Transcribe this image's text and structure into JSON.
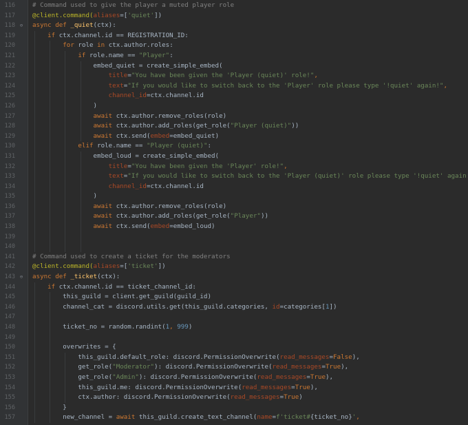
{
  "editor": {
    "lines": [
      {
        "n": "116",
        "tokens": [
          {
            "t": "# Command used to give the player a muted player role",
            "c": "com"
          }
        ]
      },
      {
        "n": "117",
        "tokens": [
          {
            "t": "@client.command(",
            "c": "dec"
          },
          {
            "t": "aliases",
            "c": "par"
          },
          {
            "t": "=[",
            "c": ""
          },
          {
            "t": "'quiet'",
            "c": "str"
          },
          {
            "t": "])",
            "c": ""
          }
        ]
      },
      {
        "n": "118",
        "fold": true,
        "tokens": [
          {
            "t": "async def ",
            "c": "kw"
          },
          {
            "t": "_quiet",
            "c": "fn"
          },
          {
            "t": "(ctx):",
            "c": ""
          }
        ]
      },
      {
        "n": "119",
        "tokens": [
          {
            "t": "    ",
            "c": ""
          },
          {
            "t": "if ",
            "c": "kw"
          },
          {
            "t": "ctx.channel.id == REGISTRATION_ID:",
            "c": ""
          }
        ]
      },
      {
        "n": "120",
        "tokens": [
          {
            "t": "        ",
            "c": ""
          },
          {
            "t": "for ",
            "c": "kw"
          },
          {
            "t": "role ",
            "c": ""
          },
          {
            "t": "in ",
            "c": "kw"
          },
          {
            "t": "ctx.author.roles:",
            "c": ""
          }
        ]
      },
      {
        "n": "121",
        "tokens": [
          {
            "t": "            ",
            "c": ""
          },
          {
            "t": "if ",
            "c": "kw"
          },
          {
            "t": "role.name == ",
            "c": ""
          },
          {
            "t": "\"Player\"",
            "c": "str"
          },
          {
            "t": ":",
            "c": ""
          }
        ]
      },
      {
        "n": "122",
        "tokens": [
          {
            "t": "                embed_quiet = create_simple_embed(",
            "c": ""
          }
        ]
      },
      {
        "n": "123",
        "tokens": [
          {
            "t": "                    ",
            "c": ""
          },
          {
            "t": "title",
            "c": "par"
          },
          {
            "t": "=",
            "c": ""
          },
          {
            "t": "\"You have been given the 'Player (quiet)' role!\"",
            "c": "str"
          },
          {
            "t": ",",
            "c": "sb"
          }
        ]
      },
      {
        "n": "124",
        "tokens": [
          {
            "t": "                    ",
            "c": ""
          },
          {
            "t": "text",
            "c": "par"
          },
          {
            "t": "=",
            "c": ""
          },
          {
            "t": "\"If you would like to switch back to the 'Player' role please type '!quiet' again!\"",
            "c": "str"
          },
          {
            "t": ",",
            "c": "sb"
          }
        ]
      },
      {
        "n": "125",
        "tokens": [
          {
            "t": "                    ",
            "c": ""
          },
          {
            "t": "channel_id",
            "c": "par"
          },
          {
            "t": "=ctx.channel.id",
            "c": ""
          }
        ]
      },
      {
        "n": "126",
        "tokens": [
          {
            "t": "                )",
            "c": ""
          }
        ]
      },
      {
        "n": "127",
        "tokens": [
          {
            "t": "                ",
            "c": ""
          },
          {
            "t": "await ",
            "c": "kw"
          },
          {
            "t": "ctx.author.remove_roles(role)",
            "c": ""
          }
        ]
      },
      {
        "n": "128",
        "tokens": [
          {
            "t": "                ",
            "c": ""
          },
          {
            "t": "await ",
            "c": "kw"
          },
          {
            "t": "ctx.author.add_roles(get_role(",
            "c": ""
          },
          {
            "t": "\"Player (quiet)\"",
            "c": "str"
          },
          {
            "t": "))",
            "c": ""
          }
        ]
      },
      {
        "n": "129",
        "tokens": [
          {
            "t": "                ",
            "c": ""
          },
          {
            "t": "await ",
            "c": "kw"
          },
          {
            "t": "ctx.send(",
            "c": ""
          },
          {
            "t": "embed",
            "c": "par"
          },
          {
            "t": "=embed_quiet)",
            "c": ""
          }
        ]
      },
      {
        "n": "130",
        "tokens": [
          {
            "t": "            ",
            "c": ""
          },
          {
            "t": "elif ",
            "c": "kw"
          },
          {
            "t": "role.name == ",
            "c": ""
          },
          {
            "t": "\"Player (quiet)\"",
            "c": "str"
          },
          {
            "t": ":",
            "c": ""
          }
        ]
      },
      {
        "n": "131",
        "tokens": [
          {
            "t": "                embed_loud = create_simple_embed(",
            "c": ""
          }
        ]
      },
      {
        "n": "132",
        "tokens": [
          {
            "t": "                    ",
            "c": ""
          },
          {
            "t": "title",
            "c": "par"
          },
          {
            "t": "=",
            "c": ""
          },
          {
            "t": "\"You have been given the 'Player' role!\"",
            "c": "str"
          },
          {
            "t": ",",
            "c": "sb"
          }
        ]
      },
      {
        "n": "133",
        "tokens": [
          {
            "t": "                    ",
            "c": ""
          },
          {
            "t": "text",
            "c": "par"
          },
          {
            "t": "=",
            "c": ""
          },
          {
            "t": "\"If you would like to switch back to the 'Player (quiet)' role please type '!quiet' again!\"",
            "c": "str"
          },
          {
            "t": ",",
            "c": "sb"
          }
        ]
      },
      {
        "n": "134",
        "tokens": [
          {
            "t": "                    ",
            "c": ""
          },
          {
            "t": "channel_id",
            "c": "par"
          },
          {
            "t": "=ctx.channel.id",
            "c": ""
          }
        ]
      },
      {
        "n": "135",
        "tokens": [
          {
            "t": "                )",
            "c": ""
          }
        ]
      },
      {
        "n": "136",
        "tokens": [
          {
            "t": "                ",
            "c": ""
          },
          {
            "t": "await ",
            "c": "kw"
          },
          {
            "t": "ctx.author.remove_roles(role)",
            "c": ""
          }
        ]
      },
      {
        "n": "137",
        "tokens": [
          {
            "t": "                ",
            "c": ""
          },
          {
            "t": "await ",
            "c": "kw"
          },
          {
            "t": "ctx.author.add_roles(get_role(",
            "c": ""
          },
          {
            "t": "\"Player\"",
            "c": "str"
          },
          {
            "t": "))",
            "c": ""
          }
        ]
      },
      {
        "n": "138",
        "tokens": [
          {
            "t": "                ",
            "c": ""
          },
          {
            "t": "await ",
            "c": "kw"
          },
          {
            "t": "ctx.send(",
            "c": ""
          },
          {
            "t": "embed",
            "c": "par"
          },
          {
            "t": "=embed_loud)",
            "c": ""
          }
        ]
      },
      {
        "n": "139",
        "tokens": []
      },
      {
        "n": "140",
        "tokens": []
      },
      {
        "n": "141",
        "tokens": [
          {
            "t": "# Command used to create a ticket for the moderators",
            "c": "com"
          }
        ]
      },
      {
        "n": "142",
        "tokens": [
          {
            "t": "@client.command(",
            "c": "dec"
          },
          {
            "t": "aliases",
            "c": "par"
          },
          {
            "t": "=[",
            "c": ""
          },
          {
            "t": "'ticket'",
            "c": "str"
          },
          {
            "t": "])",
            "c": ""
          }
        ]
      },
      {
        "n": "143",
        "fold": true,
        "tokens": [
          {
            "t": "async def ",
            "c": "kw"
          },
          {
            "t": "_ticket",
            "c": "fn"
          },
          {
            "t": "(ctx):",
            "c": ""
          }
        ]
      },
      {
        "n": "144",
        "tokens": [
          {
            "t": "    ",
            "c": ""
          },
          {
            "t": "if ",
            "c": "kw"
          },
          {
            "t": "ctx.channel.id == ticket_channel_id:",
            "c": ""
          }
        ]
      },
      {
        "n": "145",
        "tokens": [
          {
            "t": "        this_guild = client.get_guild(guild_id)",
            "c": ""
          }
        ]
      },
      {
        "n": "146",
        "tokens": [
          {
            "t": "        channel_cat = discord.utils.get(this_guild.categories, ",
            "c": ""
          },
          {
            "t": "id",
            "c": "par"
          },
          {
            "t": "=categories[",
            "c": ""
          },
          {
            "t": "1",
            "c": "num"
          },
          {
            "t": "])",
            "c": ""
          }
        ]
      },
      {
        "n": "147",
        "tokens": []
      },
      {
        "n": "148",
        "tokens": [
          {
            "t": "        ticket_no = random.randint(",
            "c": ""
          },
          {
            "t": "1",
            "c": "num"
          },
          {
            "t": ", ",
            "c": "sb"
          },
          {
            "t": "999",
            "c": "num"
          },
          {
            "t": ")",
            "c": ""
          }
        ]
      },
      {
        "n": "149",
        "tokens": []
      },
      {
        "n": "150",
        "tokens": [
          {
            "t": "        overwrites = {",
            "c": ""
          }
        ]
      },
      {
        "n": "151",
        "tokens": [
          {
            "t": "            this_guild.default_role: discord.PermissionOverwrite(",
            "c": ""
          },
          {
            "t": "read_messages",
            "c": "par"
          },
          {
            "t": "=",
            "c": ""
          },
          {
            "t": "False",
            "c": "kw"
          },
          {
            "t": "),",
            "c": ""
          }
        ]
      },
      {
        "n": "152",
        "tokens": [
          {
            "t": "            get_role(",
            "c": ""
          },
          {
            "t": "\"Moderator\"",
            "c": "str"
          },
          {
            "t": "): discord.PermissionOverwrite(",
            "c": ""
          },
          {
            "t": "read_messages",
            "c": "par"
          },
          {
            "t": "=",
            "c": ""
          },
          {
            "t": "True",
            "c": "kw"
          },
          {
            "t": "),",
            "c": ""
          }
        ]
      },
      {
        "n": "153",
        "tokens": [
          {
            "t": "            get_role(",
            "c": ""
          },
          {
            "t": "\"Admin\"",
            "c": "str"
          },
          {
            "t": "): discord.PermissionOverwrite(",
            "c": ""
          },
          {
            "t": "read_messages",
            "c": "par"
          },
          {
            "t": "=",
            "c": ""
          },
          {
            "t": "True",
            "c": "kw"
          },
          {
            "t": "),",
            "c": ""
          }
        ]
      },
      {
        "n": "154",
        "tokens": [
          {
            "t": "            this_guild.me: discord.PermissionOverwrite(",
            "c": ""
          },
          {
            "t": "read_messages",
            "c": "par"
          },
          {
            "t": "=",
            "c": ""
          },
          {
            "t": "True",
            "c": "kw"
          },
          {
            "t": "),",
            "c": ""
          }
        ]
      },
      {
        "n": "155",
        "tokens": [
          {
            "t": "            ctx.author: discord.PermissionOverwrite(",
            "c": ""
          },
          {
            "t": "read_messages",
            "c": "par"
          },
          {
            "t": "=",
            "c": ""
          },
          {
            "t": "True",
            "c": "kw"
          },
          {
            "t": ")",
            "c": ""
          }
        ]
      },
      {
        "n": "156",
        "tokens": [
          {
            "t": "        }",
            "c": ""
          }
        ]
      },
      {
        "n": "157",
        "tokens": [
          {
            "t": "        new_channel = ",
            "c": ""
          },
          {
            "t": "await ",
            "c": "kw"
          },
          {
            "t": "this_guild.create_text_channel(",
            "c": ""
          },
          {
            "t": "name",
            "c": "par"
          },
          {
            "t": "=",
            "c": ""
          },
          {
            "t": "f'ticket#",
            "c": "str"
          },
          {
            "t": "{ticket_no}",
            "c": ""
          },
          {
            "t": "'",
            "c": "str"
          },
          {
            "t": ",",
            "c": "sb"
          }
        ]
      }
    ],
    "colors": {
      "background": "#2b2b2b",
      "gutter": "#313335",
      "keyword": "#cc7832",
      "string": "#6a8759",
      "number": "#6897bb",
      "comment": "#808080",
      "decorator": "#bbb529",
      "function": "#ffc66d",
      "parameter": "#aa4926",
      "text": "#a9b7c6"
    }
  }
}
